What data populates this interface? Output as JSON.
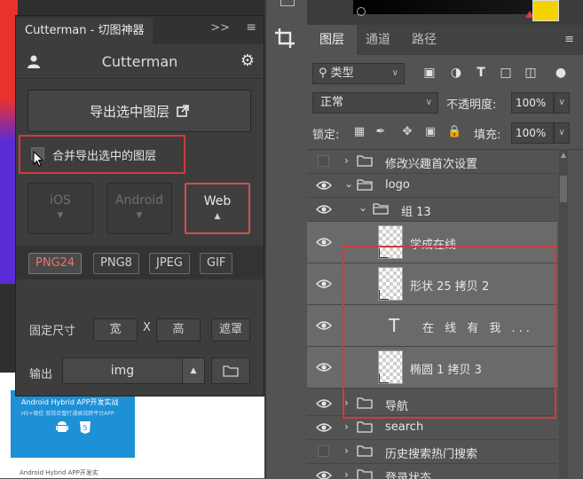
{
  "cutterman": {
    "tab_title": "Cutterman - 切图神器",
    "collapse_icon": "double-chevron-right",
    "brand": "Cutterman",
    "export_selected_label": "导出选中图层",
    "merge_export_label": "合并导出选中的图层",
    "platforms": [
      "iOS",
      "Android",
      "Web"
    ],
    "active_platform": "Web",
    "formats": [
      "PNG24",
      "PNG8",
      "JPEG",
      "GIF"
    ],
    "active_format": "PNG24",
    "fixed_size_label": "固定尺寸",
    "width_label": "宽",
    "x_label": "X",
    "height_label": "高",
    "mask_label": "遮罩",
    "output_label": "输出",
    "output_value": "img"
  },
  "layers_panel": {
    "tabs": [
      "图层",
      "通道",
      "路径"
    ],
    "active_tab": "图层",
    "filter_kind": "类型",
    "blend_mode": "正常",
    "opacity_label": "不透明度:",
    "opacity_value": "100%",
    "lock_label": "锁定:",
    "fill_label": "填充:",
    "fill_value": "100%",
    "layers": [
      {
        "name": "修改兴趣首次设置",
        "kind": "group",
        "visible": false,
        "expanded": false,
        "indent": 0
      },
      {
        "name": "logo",
        "kind": "group",
        "visible": true,
        "expanded": true,
        "indent": 0
      },
      {
        "name": "组 13",
        "kind": "group",
        "visible": true,
        "expanded": true,
        "indent": 1
      },
      {
        "name": "学成在线",
        "kind": "smart",
        "visible": true,
        "selected": true
      },
      {
        "name": "形状 25 拷贝 2",
        "kind": "smart",
        "visible": true,
        "selected": true
      },
      {
        "name": "在 线 有 我 ...",
        "kind": "text",
        "visible": true,
        "selected": true
      },
      {
        "name": "椭圆 1 拷贝 3",
        "kind": "smart",
        "visible": true,
        "selected": true
      },
      {
        "name": "导航",
        "kind": "group",
        "visible": true,
        "expanded": false,
        "indent": 0
      },
      {
        "name": "search",
        "kind": "group",
        "visible": true,
        "expanded": false,
        "indent": 0
      },
      {
        "name": "历史搜索热门搜索",
        "kind": "group",
        "visible": false,
        "expanded": false,
        "indent": 0
      },
      {
        "name": "登录状态",
        "kind": "group",
        "visible": true,
        "expanded": false,
        "indent": 0
      }
    ]
  },
  "document": {
    "card_title": "Android Hybrid APP开发实战",
    "card_sub": "H5+微信 双效合璧打通高效跨平台APP",
    "card_caption": "Android Hybrid APP开发实"
  },
  "colors": {
    "highlight_red": "#d23a3a",
    "panel_bg": "#3d3d3d",
    "layers_bg": "#535353",
    "active_format": "#f07070"
  }
}
